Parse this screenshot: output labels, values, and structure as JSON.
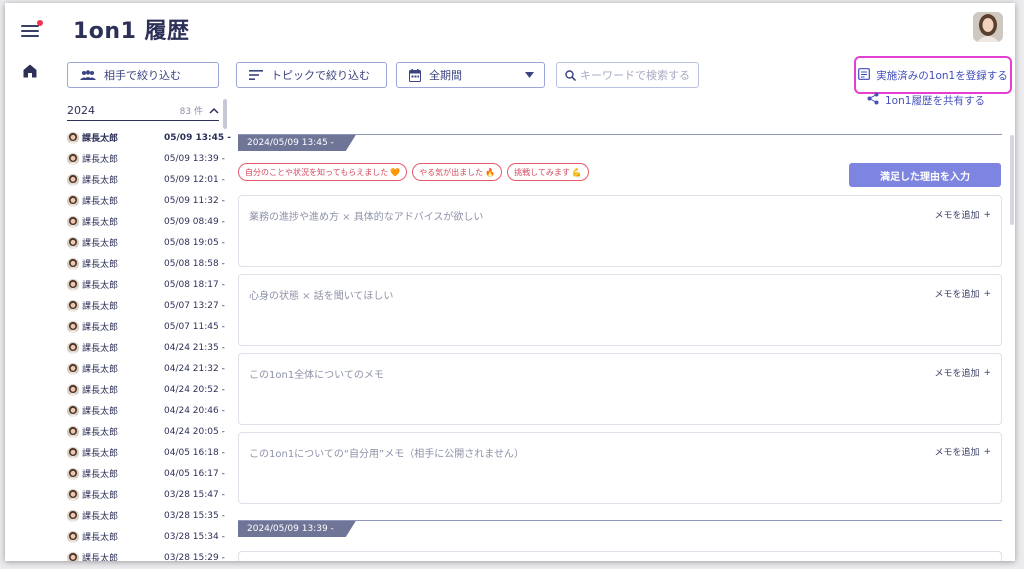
{
  "app": {
    "title": "1on1 履歴"
  },
  "filters": {
    "partner": "相手で絞り込む",
    "topic": "トピックで絞り込む",
    "period": "全期間",
    "search_placeholder": "キーワードで検索する"
  },
  "actions": {
    "register": "実施済みの1on1を登録する",
    "share": "1on1履歴を共有する",
    "reason": "満足した理由を入力"
  },
  "history": {
    "year": "2024",
    "count": "83 件",
    "items": [
      {
        "name": "課長太郎",
        "date": "05/09 13:45 -"
      },
      {
        "name": "課長太郎",
        "date": "05/09 13:39 -"
      },
      {
        "name": "課長太郎",
        "date": "05/09 12:01 -"
      },
      {
        "name": "課長太郎",
        "date": "05/09 11:32 -"
      },
      {
        "name": "課長太郎",
        "date": "05/09 08:49 -"
      },
      {
        "name": "課長太郎",
        "date": "05/08 19:05 -"
      },
      {
        "name": "課長太郎",
        "date": "05/08 18:58 -"
      },
      {
        "name": "課長太郎",
        "date": "05/08 18:17 -"
      },
      {
        "name": "課長太郎",
        "date": "05/07 13:27 -"
      },
      {
        "name": "課長太郎",
        "date": "05/07 11:45 -"
      },
      {
        "name": "課長太郎",
        "date": "04/24 21:35 -"
      },
      {
        "name": "課長太郎",
        "date": "04/24 21:32 -"
      },
      {
        "name": "課長太郎",
        "date": "04/24 20:52 -"
      },
      {
        "name": "課長太郎",
        "date": "04/24 20:46 -"
      },
      {
        "name": "課長太郎",
        "date": "04/24 20:05 -"
      },
      {
        "name": "課長太郎",
        "date": "04/05 16:18 -"
      },
      {
        "name": "課長太郎",
        "date": "04/05 16:17 -"
      },
      {
        "name": "課長太郎",
        "date": "03/28 15:47 -"
      },
      {
        "name": "課長太郎",
        "date": "03/28 15:35 -"
      },
      {
        "name": "課長太郎",
        "date": "03/28 15:34 -"
      },
      {
        "name": "課長太郎",
        "date": "03/28 15:29 -"
      }
    ]
  },
  "session": {
    "date": "2024/05/09 13:45 -",
    "tags": [
      {
        "label": "自分のことや状況を知ってもらえました",
        "emoji": "🧡"
      },
      {
        "label": "やる気が出ました",
        "emoji": "🔥"
      },
      {
        "label": "挑戦してみます",
        "emoji": "💪"
      }
    ],
    "memos": [
      {
        "title": "業務の進捗や進め方 × 具体的なアドバイスが欲しい",
        "add": "メモを追加"
      },
      {
        "title": "心身の状態 × 話を聞いてほしい",
        "add": "メモを追加"
      },
      {
        "title": "この1on1全体についてのメモ",
        "add": "メモを追加"
      },
      {
        "title": "この1on1についての“自分用”メモ（相手に公開されません）",
        "add": "メモを追加"
      }
    ]
  },
  "next_session": {
    "date": "2024/05/09 13:39 -"
  },
  "colors": {
    "accent": "#7d85e0",
    "highlight": "#e43fd0",
    "tag": "#e65b6c",
    "date_tab": "#6f7597"
  }
}
